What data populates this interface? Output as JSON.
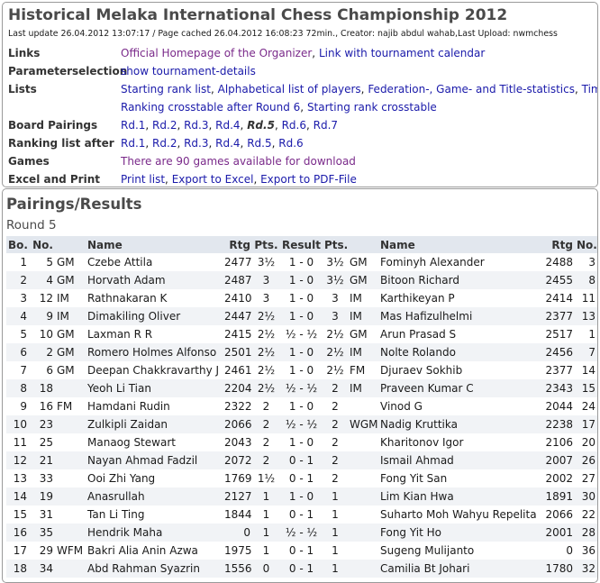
{
  "header": {
    "title": "Historical Melaka International Chess Championship 2012",
    "subtitle": "Last update 26.04.2012 13:07:17 / Page cached 26.04.2012 16:08:23 72min., Creator: najib abdul wahab,Last Upload: nwmchess"
  },
  "info": {
    "links": {
      "label": "Links",
      "items": [
        "Official Homepage of the Organizer",
        "Link with tournament calendar"
      ]
    },
    "params": {
      "label": "Parameterselection",
      "item": "show tournament-details"
    },
    "lists": {
      "label": "Lists",
      "items": [
        "Starting rank list",
        "Alphabetical list of players",
        "Federation-, Game- and Title-statistics",
        "Time-ta"
      ],
      "items2": [
        "Ranking crosstable after Round 6",
        "Starting rank crosstable"
      ]
    },
    "pairings": {
      "label": "Board Pairings",
      "rounds": [
        "Rd.1",
        "Rd.2",
        "Rd.3",
        "Rd.4",
        "Rd.5",
        "Rd.6",
        "Rd.7"
      ]
    },
    "ranking": {
      "label": "Ranking list after",
      "rounds": [
        "Rd.1",
        "Rd.2",
        "Rd.3",
        "Rd.4",
        "Rd.5",
        "Rd.6"
      ]
    },
    "games": {
      "label": "Games",
      "item": "There are 90 games available for download"
    },
    "excel": {
      "label": "Excel and Print",
      "items": [
        "Print list",
        "Export to Excel",
        "Export to PDF-File"
      ]
    }
  },
  "pairings_section": {
    "title": "Pairings/Results",
    "round_label": "Round 5",
    "columns": [
      "Bo.",
      "No.",
      "",
      "Name",
      "Rtg",
      "Pts.",
      "Result",
      "Pts.",
      "",
      "Name",
      "Rtg",
      "No."
    ],
    "rows": [
      [
        "1",
        "5",
        "GM",
        "Czebe Attila",
        "2477",
        "3½",
        "1 - 0",
        "3½",
        "GM",
        "Fominyh Alexander",
        "2488",
        "3"
      ],
      [
        "2",
        "4",
        "GM",
        "Horvath Adam",
        "2487",
        "3",
        "1 - 0",
        "3½",
        "GM",
        "Bitoon Richard",
        "2455",
        "8"
      ],
      [
        "3",
        "12",
        "IM",
        "Rathnakaran K",
        "2410",
        "3",
        "1 - 0",
        "3",
        "IM",
        "Karthikeyan P",
        "2414",
        "11"
      ],
      [
        "4",
        "9",
        "IM",
        "Dimakiling Oliver",
        "2447",
        "2½",
        "1 - 0",
        "3",
        "IM",
        "Mas Hafizulhelmi",
        "2377",
        "13"
      ],
      [
        "5",
        "10",
        "GM",
        "Laxman R R",
        "2415",
        "2½",
        "½ - ½",
        "2½",
        "GM",
        "Arun Prasad S",
        "2517",
        "1"
      ],
      [
        "6",
        "2",
        "GM",
        "Romero Holmes Alfonso",
        "2501",
        "2½",
        "1 - 0",
        "2½",
        "IM",
        "Nolte Rolando",
        "2456",
        "7"
      ],
      [
        "7",
        "6",
        "GM",
        "Deepan Chakkravarthy J",
        "2461",
        "2½",
        "1 - 0",
        "2½",
        "FM",
        "Djuraev Sokhib",
        "2377",
        "14"
      ],
      [
        "8",
        "18",
        "",
        "Yeoh Li Tian",
        "2204",
        "2½",
        "½ - ½",
        "2",
        "IM",
        "Praveen Kumar C",
        "2343",
        "15"
      ],
      [
        "9",
        "16",
        "FM",
        "Hamdani Rudin",
        "2322",
        "2",
        "1 - 0",
        "2",
        "",
        "Vinod G",
        "2044",
        "24"
      ],
      [
        "10",
        "23",
        "",
        "Zulkipli Zaidan",
        "2066",
        "2",
        "½ - ½",
        "2",
        "WGM",
        "Nadig Kruttika",
        "2238",
        "17"
      ],
      [
        "11",
        "25",
        "",
        "Manaog Stewart",
        "2043",
        "2",
        "1 - 0",
        "2",
        "",
        "Kharitonov Igor",
        "2106",
        "20"
      ],
      [
        "12",
        "21",
        "",
        "Nayan Ahmad Fadzil",
        "2072",
        "2",
        "0 - 1",
        "2",
        "",
        "Ismail Ahmad",
        "2007",
        "26"
      ],
      [
        "13",
        "33",
        "",
        "Ooi Zhi Yang",
        "1769",
        "1½",
        "0 - 1",
        "2",
        "",
        "Fong Yit San",
        "2002",
        "27"
      ],
      [
        "14",
        "19",
        "",
        "Anasrullah",
        "2127",
        "1",
        "1 - 0",
        "1",
        "",
        "Lim Kian Hwa",
        "1891",
        "30"
      ],
      [
        "15",
        "31",
        "",
        "Tan Li Ting",
        "1844",
        "1",
        "0 - 1",
        "1",
        "",
        "Suharto Moh Wahyu Repelita",
        "2066",
        "22"
      ],
      [
        "16",
        "35",
        "",
        "Hendrik Maha",
        "0",
        "1",
        "½ - ½",
        "1",
        "",
        "Fong Yit Ho",
        "2001",
        "28"
      ],
      [
        "17",
        "29",
        "WFM",
        "Bakri Alia Anin Azwa",
        "1975",
        "1",
        "0 - 1",
        "1",
        "",
        "Sugeng Mulijanto",
        "0",
        "36"
      ],
      [
        "18",
        "34",
        "",
        "Abd Rahman Syazrin",
        "1556",
        "0",
        "0 - 1",
        "1",
        "",
        "Camilia Bt Johari",
        "1780",
        "32"
      ]
    ]
  }
}
